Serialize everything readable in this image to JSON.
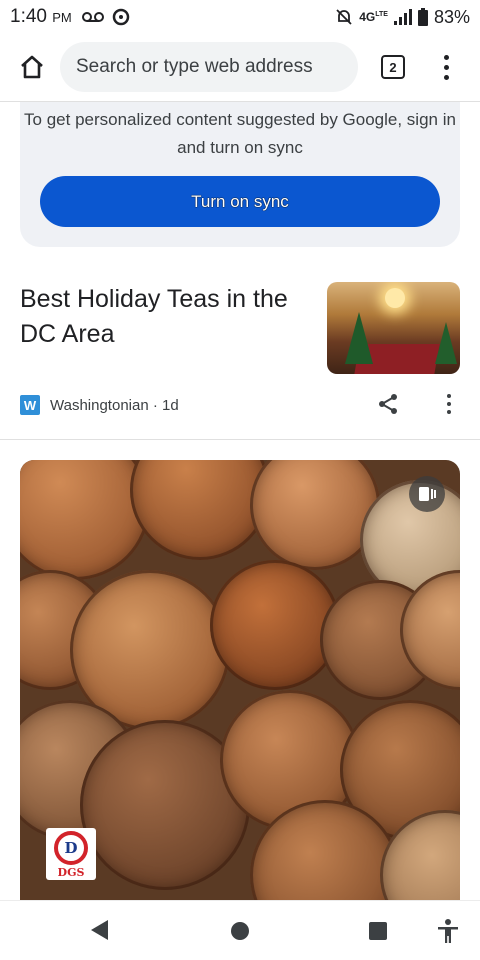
{
  "status_bar": {
    "time": "1:40",
    "time_suffix": "PM",
    "network": "4G",
    "network_suffix": "LTE",
    "battery": "83%",
    "icons": [
      "voicemail-icon",
      "notification-icon",
      "mute-icon",
      "signal-icon",
      "battery-icon"
    ]
  },
  "toolbar": {
    "omnibox_placeholder": "Search or type web address",
    "tab_count": "2",
    "icons": [
      "home-icon",
      "menu-icon"
    ]
  },
  "sync_promo": {
    "message": "To get personalized content suggested by Google, sign in and turn on sync",
    "button_label": "Turn on sync",
    "button_color": "#0b57d0"
  },
  "article": {
    "title": "Best Holiday Teas in the DC Area",
    "source_logo_letter": "W",
    "source": "Washingtonian",
    "age": "· 1d",
    "icons": [
      "share-icon",
      "more-vert-icon"
    ]
  },
  "video_card": {
    "badge_icon": "video-icon",
    "publisher_logo_text": "DGS"
  },
  "nav_bar": {
    "icons": [
      "back-icon",
      "home-icon",
      "recents-icon",
      "accessibility-icon"
    ]
  }
}
